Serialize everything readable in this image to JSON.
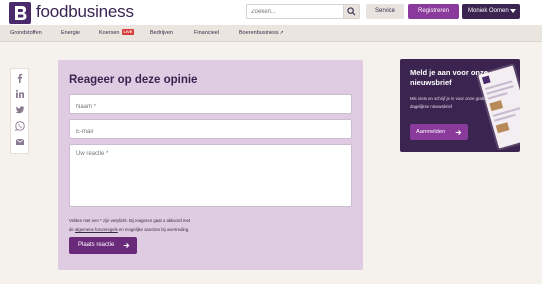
{
  "header": {
    "brand": "foodbusiness",
    "search_placeholder": "Zoeken...",
    "service_label": "Service",
    "register_label": "Registreren",
    "user_label": "Moniek Oomen"
  },
  "nav": {
    "items": [
      {
        "label": "Grondstoffen"
      },
      {
        "label": "Energie"
      },
      {
        "label": "Koersen",
        "badge": "LIVE"
      },
      {
        "label": "Bedrijven"
      },
      {
        "label": "Financieel"
      },
      {
        "label": "Boerenbusiness",
        "external": true
      }
    ]
  },
  "share": {
    "icons": [
      "facebook-icon",
      "linkedin-icon",
      "twitter-icon",
      "whatsapp-icon",
      "email-icon"
    ]
  },
  "comment_form": {
    "title": "Reageer op deze opinie",
    "name_placeholder": "Naam *",
    "email_placeholder": "E-mail",
    "comment_placeholder": "Uw reactie *",
    "legal_line1": "Velden met een * zijn verplicht. Bij reageren gaat u akkoord met",
    "legal_prefix": "de ",
    "legal_link": "algemene forumregels",
    "legal_suffix": " en mogelijke sancties bij overtreding.",
    "submit_label": "Plaats reactie"
  },
  "newsletter": {
    "title": "Meld je aan voor onze nieuwsbrief",
    "text": "Mis niets en schrijf je in voor onze gratis dagelijkse nieuwsbrief",
    "button_label": "Aanmelden"
  },
  "colors": {
    "brand_purple": "#3b2450",
    "accent_purple": "#8a3a9a",
    "panel_lilac": "#dfcbe2",
    "live_red": "#d93a3a"
  }
}
